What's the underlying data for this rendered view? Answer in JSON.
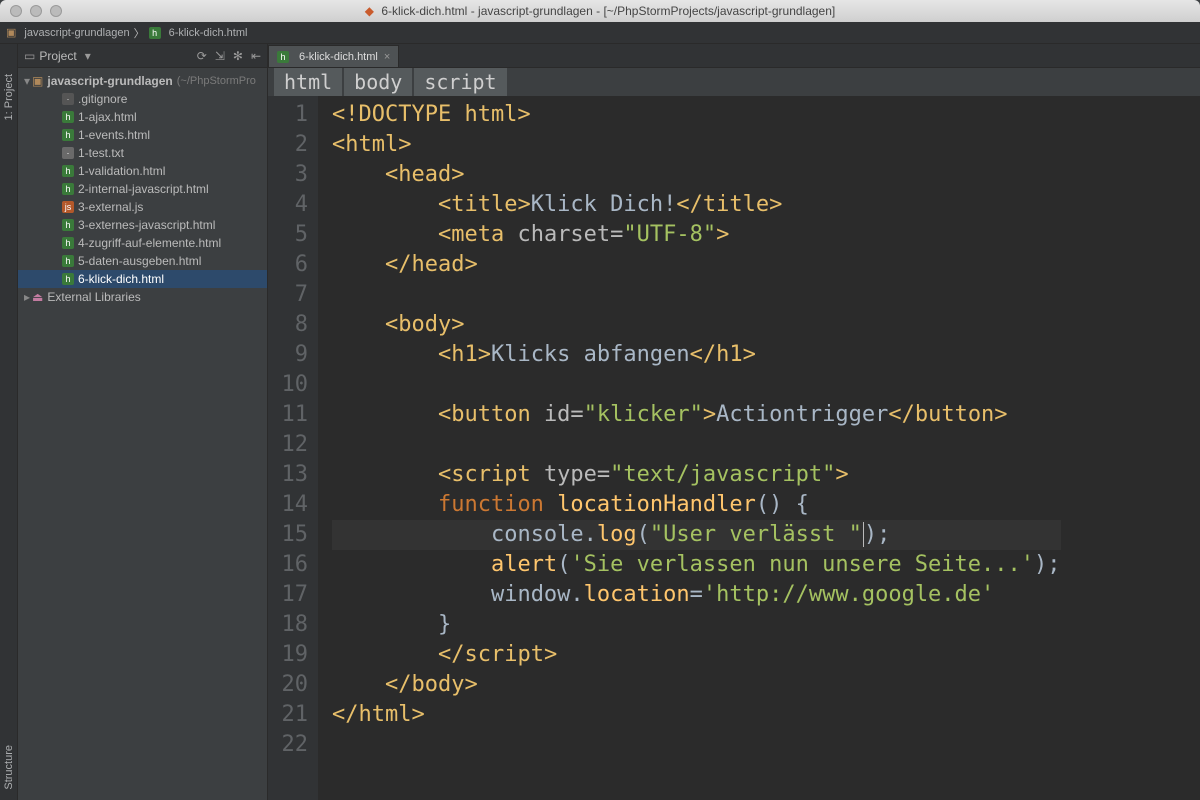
{
  "window": {
    "title_file": "6-klick-dich.html",
    "title_proj": "javascript-grundlagen",
    "title_path": "[~/PhpStormProjects/javascript-grundlagen]"
  },
  "crumbs": {
    "folder": "javascript-grundlagen",
    "file": "6-klick-dich.html"
  },
  "toolstrip": {
    "project": "1: Project",
    "structure": "Structure"
  },
  "project_panel": {
    "title": "Project",
    "root": "javascript-grundlagen",
    "root_dim": "(~/PhpStormPro",
    "files": [
      {
        "name": ".gitignore",
        "icon": "gen"
      },
      {
        "name": "1-ajax.html",
        "icon": "html"
      },
      {
        "name": "1-events.html",
        "icon": "html"
      },
      {
        "name": "1-test.txt",
        "icon": "txt"
      },
      {
        "name": "1-validation.html",
        "icon": "html"
      },
      {
        "name": "2-internal-javascript.html",
        "icon": "html"
      },
      {
        "name": "3-external.js",
        "icon": "js"
      },
      {
        "name": "3-externes-javascript.html",
        "icon": "html"
      },
      {
        "name": "4-zugriff-auf-elemente.html",
        "icon": "html"
      },
      {
        "name": "5-daten-ausgeben.html",
        "icon": "html"
      },
      {
        "name": "6-klick-dich.html",
        "icon": "html",
        "selected": true
      }
    ],
    "external": "External Libraries"
  },
  "editor": {
    "tab": "6-klick-dich.html",
    "breadcrumb": [
      "html",
      "body",
      "script"
    ],
    "lines": [
      1,
      2,
      3,
      4,
      5,
      6,
      7,
      8,
      9,
      10,
      11,
      12,
      13,
      14,
      15,
      16,
      17,
      18,
      19,
      20,
      21,
      22
    ],
    "current_line": 15,
    "code": {
      "l1": "<!DOCTYPE html>",
      "l2": "<html>",
      "l3_open": "<head>",
      "l4_title_open": "<title>",
      "l4_title_text": "Klick Dich!",
      "l4_title_close": "</title>",
      "l5_meta": "<meta ",
      "l5_attr": "charset=",
      "l5_val": "\"UTF-8\"",
      "l5_close": ">",
      "l6": "</head>",
      "l8": "<body>",
      "l9_open": "<h1>",
      "l9_text": "Klicks abfangen",
      "l9_close": "</h1>",
      "l11_open": "<button ",
      "l11_attr": "id=",
      "l11_val": "\"klicker\"",
      "l11_mid": ">",
      "l11_text": "Actiontrigger",
      "l11_close": "</button>",
      "l13_open": "<script ",
      "l13_attr": "type=",
      "l13_val": "\"text/javascript\"",
      "l13_close": ">",
      "l14_kw": "function ",
      "l14_fn": "locationHandler",
      "l14_rest": "() {",
      "l15_a": "console.",
      "l15_b": "log",
      "l15_c": "(",
      "l15_str": "\"User verlässt \"",
      "l15_d": ");",
      "l16_a": "alert",
      "l16_b": "(",
      "l16_str": "'Sie verlassen nun unsere Seite...'",
      "l16_c": ");",
      "l17_a": "window.",
      "l17_b": "location",
      "l17_c": "=",
      "l17_str": "'http://www.google.de'",
      "l18": "}",
      "l19": "</",
      "l19b": "script>",
      "l20": "</body>",
      "l21": "</html>"
    }
  }
}
